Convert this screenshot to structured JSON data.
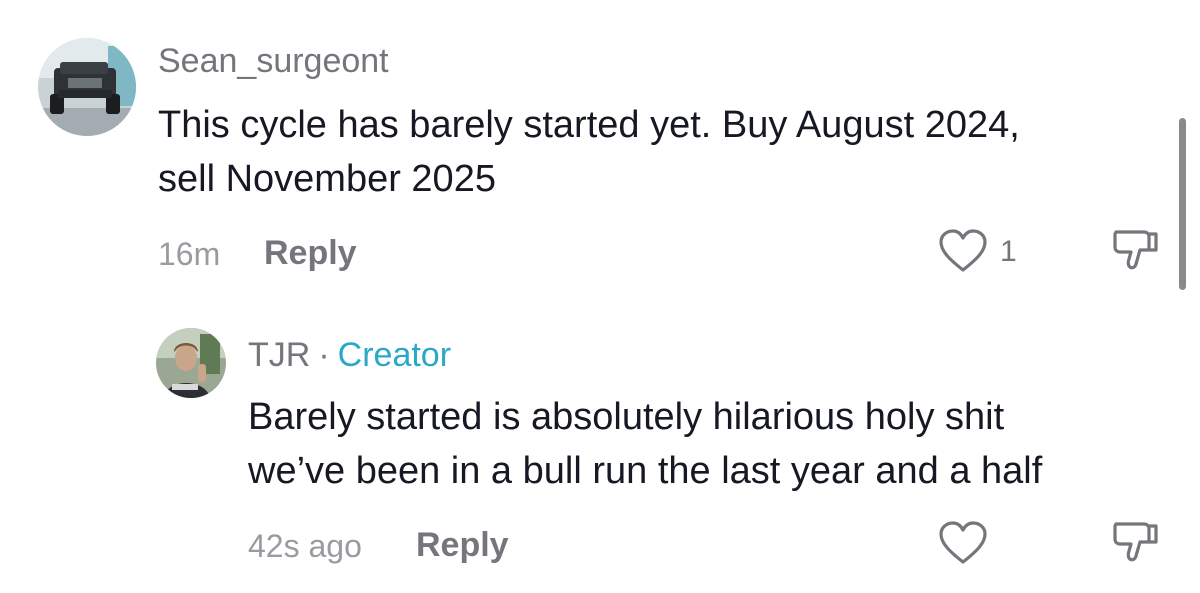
{
  "comments": [
    {
      "username": "Sean_surgeont",
      "text_line1": "This cycle has barely started yet. Buy August 2024,",
      "text_line2": "sell November 2025",
      "time": "16m",
      "reply_label": "Reply",
      "like_count": "1",
      "avatar_icon": "truck-avatar"
    },
    {
      "username": "TJR",
      "separator": "·",
      "badge": "Creator",
      "text_line1": "Barely started is absolutely hilarious holy shit",
      "text_line2": "we’ve been in a bull run the last year and a half",
      "time": "42s ago",
      "reply_label": "Reply",
      "avatar_icon": "person-avatar"
    }
  ],
  "colors": {
    "username": "#75767c",
    "creator": "#2ba7c7",
    "text": "#161823",
    "meta": "#9a9ba1"
  }
}
